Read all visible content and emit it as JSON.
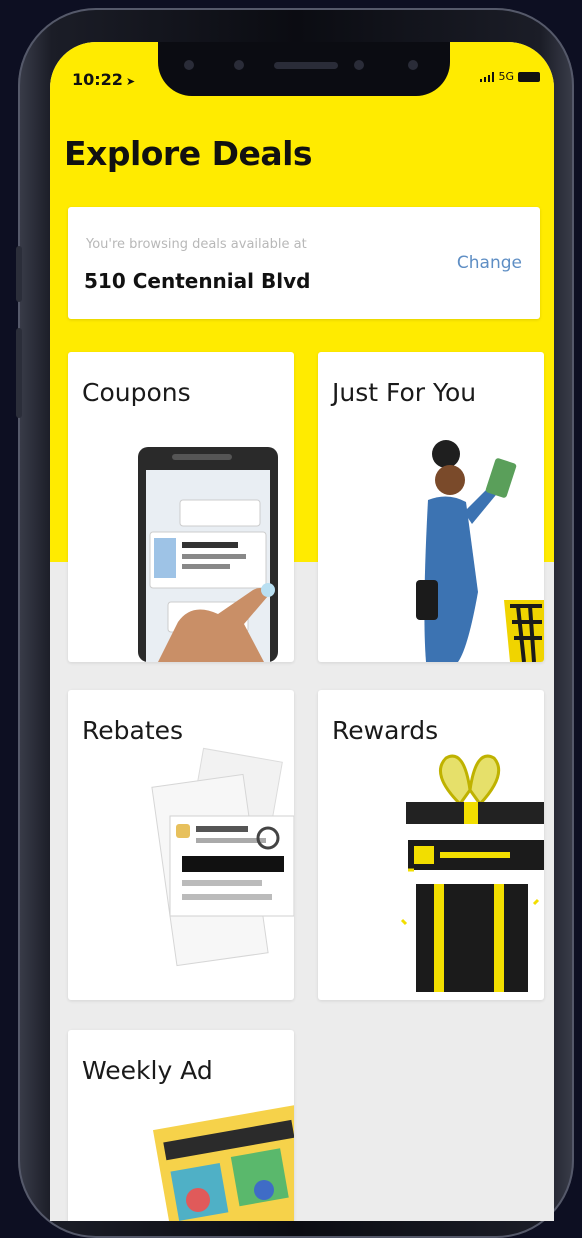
{
  "status_bar": {
    "time": "10:22",
    "location_arrow": "location-arrow-icon",
    "signal": "signal-icon",
    "network": "5G",
    "battery": "battery-icon"
  },
  "header": {
    "title": "Explore Deals"
  },
  "location": {
    "hint": "You're browsing deals available at",
    "address": "510 Centennial Blvd",
    "change_label": "Change"
  },
  "tiles": [
    {
      "id": "coupons",
      "label": "Coupons"
    },
    {
      "id": "just-for-you",
      "label": "Just For You"
    },
    {
      "id": "rebates",
      "label": "Rebates"
    },
    {
      "id": "rewards",
      "label": "Rewards"
    },
    {
      "id": "weekly-ad",
      "label": "Weekly Ad"
    }
  ],
  "colors": {
    "brand_yellow": "#ffeb00",
    "link_blue": "#5e8ec4",
    "background": "#ececec",
    "card": "#ffffff"
  }
}
